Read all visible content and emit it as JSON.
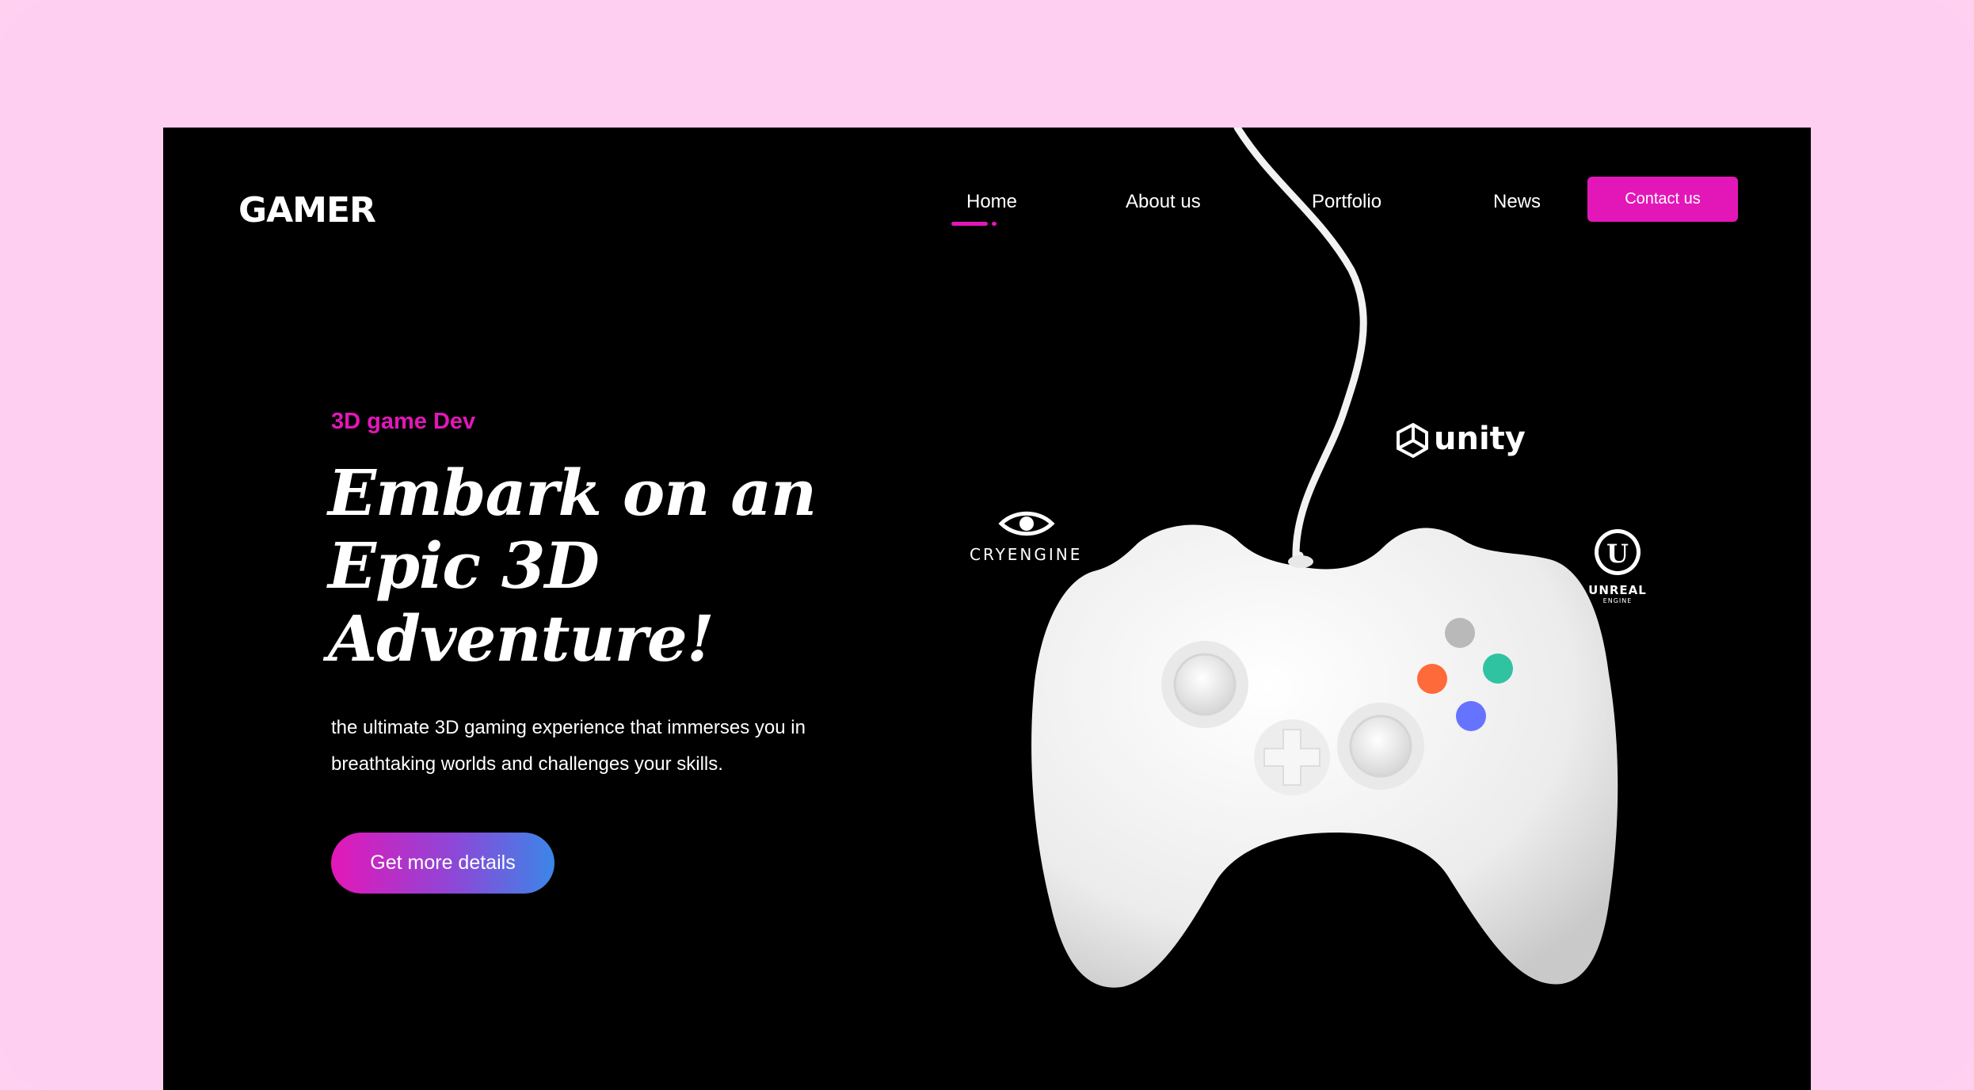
{
  "brand": {
    "logo_text": "GAMER"
  },
  "nav": {
    "items": [
      {
        "label": "Home",
        "active": true
      },
      {
        "label": "About us"
      },
      {
        "label": "Portfolio"
      },
      {
        "label": "News"
      }
    ],
    "contact_label": "Contact us"
  },
  "hero": {
    "eyebrow": "3D game Dev",
    "headline_lines": [
      "Embark on an",
      "Epic 3D",
      "Adventure!"
    ],
    "description_lines": [
      "the ultimate 3D gaming experience that immerses you in",
      "breathtaking worlds and challenges your skills."
    ],
    "cta_label": "Get more details"
  },
  "engines": {
    "cryengine": "CRYENGINE",
    "unity": "unity",
    "unreal_top": "UNREAL",
    "unreal_bottom": "ENGINE"
  },
  "colors": {
    "accent": "#e317b8",
    "page_bg": "#fecff0",
    "screen_bg": "#000000",
    "cta_gradient": [
      "#e317b8",
      "#3b86e8"
    ],
    "controller_buttons": [
      "#b9b9b9",
      "#ff6a3a",
      "#2fc3a2",
      "#6673ff"
    ]
  },
  "icons": {
    "logo_gamepad": "gamepad-icon",
    "unity_logo": "unity-cube-icon",
    "cryengine_logo": "eye-icon",
    "unreal_logo": "unreal-u-icon"
  }
}
